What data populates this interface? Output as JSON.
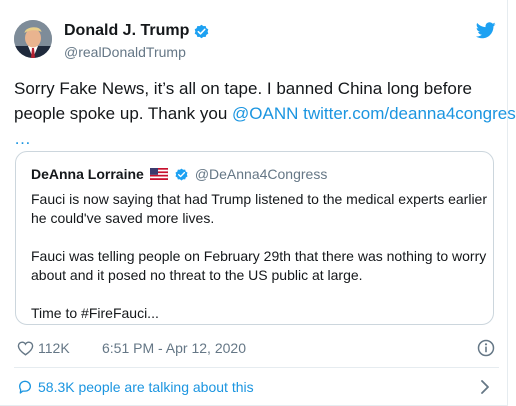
{
  "author": {
    "display_name": "Donald J. Trump",
    "handle": "@realDonaldTrump"
  },
  "tweet": {
    "text_line1": "Sorry Fake News, it’s all on tape. I banned China long before",
    "text_line2_plain": "people spoke up. Thank you ",
    "mention": "@OANN",
    "link": "twitter.com/deanna4congres",
    "link_ellipsis": "…"
  },
  "quote": {
    "display_name": "DeAnna Lorraine",
    "handle": "@DeAnna4Congress",
    "body_line1": "Fauci is now saying that had Trump listened to the medical experts earlier",
    "body_line2": "he could've saved more lives.",
    "body_line3": "Fauci was telling people on February 29th that there was nothing to worry",
    "body_line4": "about and it posed no threat to the US public at large.",
    "body_line5": "Time to #FireFauci..."
  },
  "stats": {
    "likes": "112K",
    "timestamp": "6:51 PM - Apr 12, 2020"
  },
  "footer": {
    "talking_label": "58.3K people are talking about this"
  },
  "icons": {
    "verified": "verified-badge-icon",
    "twitter": "twitter-bird-icon",
    "like": "heart-icon",
    "info": "info-icon",
    "talk": "speech-bubble-icon",
    "chevron": "chevron-right-icon",
    "flag": "us-flag-icon"
  },
  "colors": {
    "accent": "#1b95e0",
    "verified": "#1da1f2",
    "muted_text": "#657786",
    "border": "#ccd6dd"
  }
}
